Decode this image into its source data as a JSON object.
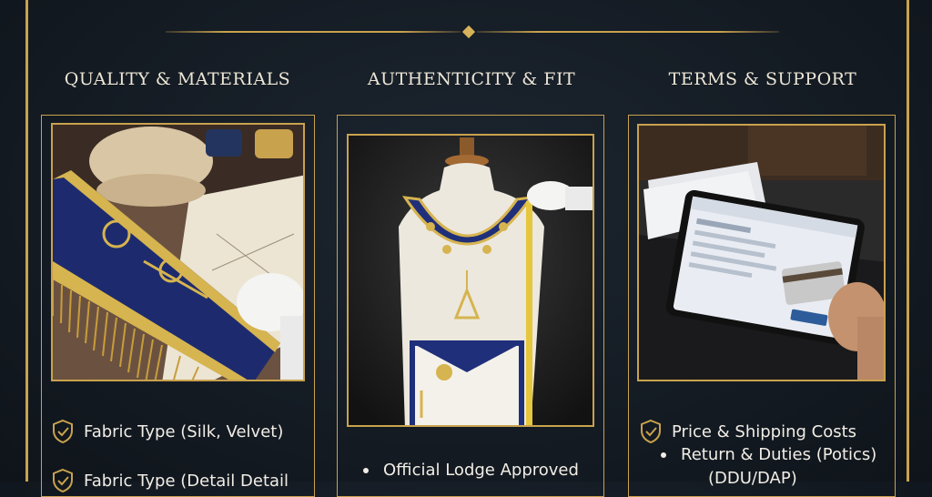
{
  "sections": [
    {
      "heading": "QUALITY & MATERIALS",
      "photo_icon": "embroidered-sash-photo",
      "items": [
        "Fabric Type (Silk, Velvet)",
        "Fabric Type (Detail Detail"
      ]
    },
    {
      "heading": "AUTHENTICITY & FIT",
      "photo_icon": "regalia-mannequin-photo",
      "items": [
        "Official Lodge Approved"
      ]
    },
    {
      "heading": "TERMS & SUPPORT",
      "photo_icon": "tablet-payment-photo",
      "items": [
        "Price & Shipping Costs",
        "Return & Duties (Potics)",
        "(DDU/DAP)"
      ]
    }
  ],
  "colors": {
    "gold": "#c9a24e",
    "background": "#141b23",
    "text": "#f1ede6"
  },
  "icons": {
    "check": "shield-check-icon",
    "divider": "diamond-ornament-icon"
  }
}
